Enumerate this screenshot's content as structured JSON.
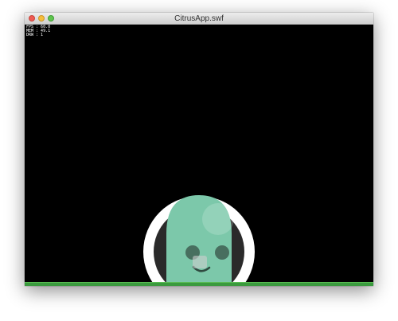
{
  "window": {
    "title": "CitrusApp.swf"
  },
  "stats": {
    "fps": "FPS : 60.0",
    "mem": "MEM : 49.1",
    "drw": "DRW : 1"
  },
  "colors": {
    "stage_background": "#000000",
    "ground": "#3a9a3e",
    "hero_body": "#7cc8aa",
    "hero_ring": "#ffffff"
  },
  "icons": {
    "close": "close-button",
    "minimize": "minimize-button",
    "zoom": "zoom-button"
  }
}
